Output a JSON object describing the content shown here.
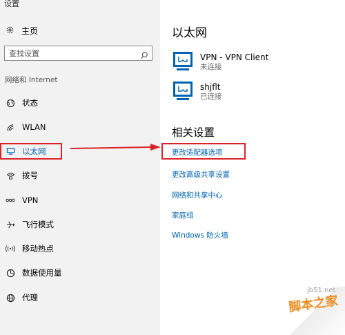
{
  "app": {
    "title": "设置"
  },
  "sidebar": {
    "home_label": "主页",
    "search_placeholder": "查找设置",
    "section_label": "网络和 Internet",
    "items": [
      {
        "label": "状态",
        "icon": "status-globe-icon"
      },
      {
        "label": "WLAN",
        "icon": "wifi-icon"
      },
      {
        "label": "以太网",
        "icon": "ethernet-icon",
        "active": true
      },
      {
        "label": "拨号",
        "icon": "dialup-icon"
      },
      {
        "label": "VPN",
        "icon": "vpn-icon"
      },
      {
        "label": "飞行模式",
        "icon": "airplane-icon"
      },
      {
        "label": "移动热点",
        "icon": "hotspot-icon"
      },
      {
        "label": "数据使用量",
        "icon": "data-usage-icon"
      },
      {
        "label": "代理",
        "icon": "proxy-globe-icon"
      }
    ]
  },
  "main": {
    "title": "以太网",
    "connections": [
      {
        "name": "VPN - VPN Client",
        "status": "未连接"
      },
      {
        "name": "shjflt",
        "status": "已连接"
      }
    ],
    "related_title": "相关设置",
    "links": [
      "更改适配器选项",
      "更改高级共享设置",
      "网络和共享中心",
      "家庭组",
      "Windows 防火墙"
    ]
  },
  "watermark": {
    "site": "jb51.net",
    "brand": "脚本之家"
  },
  "colors": {
    "accent": "#0063b1",
    "annotation": "#d9232a",
    "sidebar_bg": "#f2f2f2"
  }
}
